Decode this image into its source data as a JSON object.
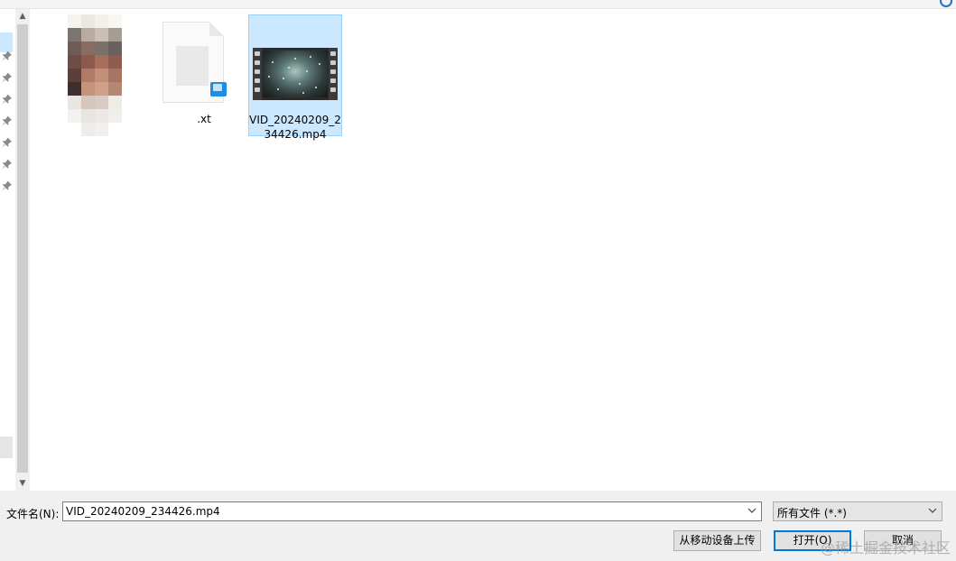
{
  "files": [
    {
      "name": "",
      "type": "image",
      "selected": false
    },
    {
      "name": ".xt",
      "type": "text-document",
      "selected": false
    },
    {
      "name": "VID_20240209_234426.mp4",
      "type": "video",
      "selected": true
    }
  ],
  "bottom_bar": {
    "filename_label": "文件名(N):",
    "filename_value": "VID_20240209_234426.mp4",
    "file_type_filter": "所有文件 (*.*)",
    "upload_button": "从移动设备上传",
    "open_button": "打开(O)",
    "cancel_button": "取消"
  },
  "watermark": "@稀土掘金技术社区",
  "colors": {
    "selection_fill": "#cce8ff",
    "selection_border": "#99d1ff",
    "default_button_border": "#0078d7"
  }
}
